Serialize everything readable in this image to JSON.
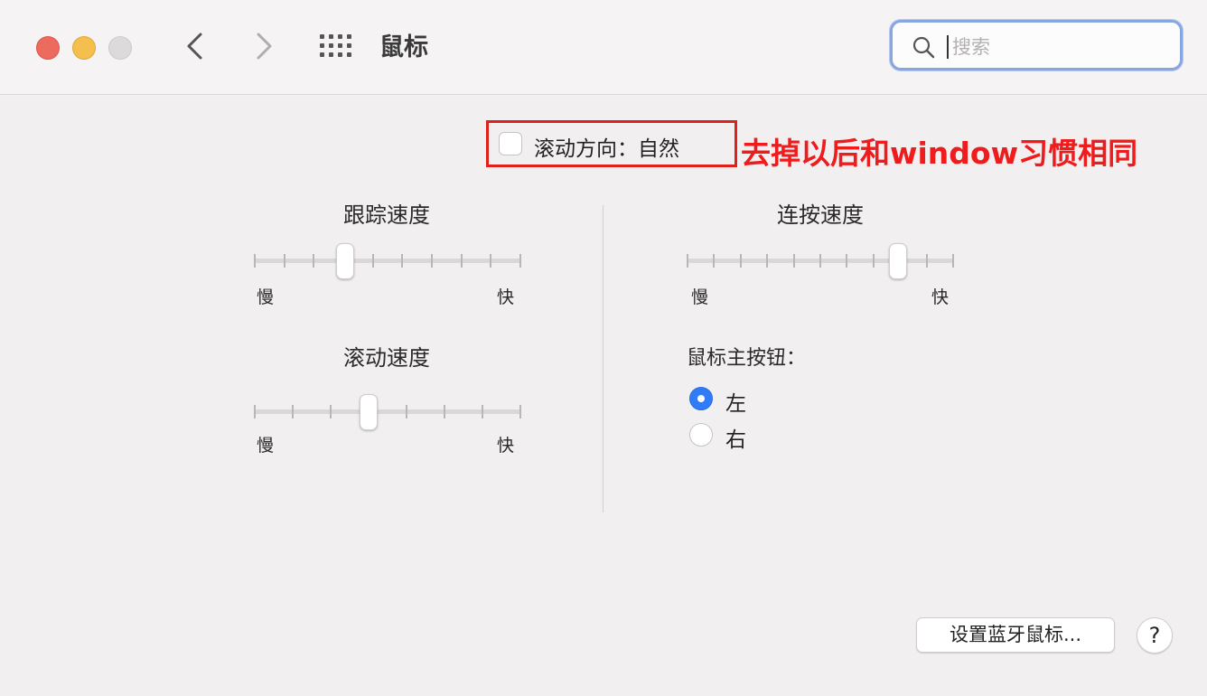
{
  "window": {
    "title": "鼠标",
    "search_placeholder": "搜索"
  },
  "icons": {
    "back": "chevron-left-icon",
    "forward": "chevron-right-icon",
    "show_all": "grid-icon",
    "search": "magnifier-icon"
  },
  "scroll_direction": {
    "label": "滚动方向：自然",
    "checked": false
  },
  "annotation": {
    "text": "去掉以后和window习惯相同",
    "color": "#ee1c1c"
  },
  "tracking_speed": {
    "title": "跟踪速度",
    "slow_label": "慢",
    "fast_label": "快",
    "value_fraction": 0.34
  },
  "scroll_speed": {
    "title": "滚动速度",
    "slow_label": "慢",
    "fast_label": "快",
    "value_fraction": 0.43
  },
  "double_click_speed": {
    "title": "连按速度",
    "slow_label": "慢",
    "fast_label": "快",
    "value_fraction": 0.79
  },
  "primary_button": {
    "label": "鼠标主按钮：",
    "options": [
      {
        "label": "左",
        "selected": true
      },
      {
        "label": "右",
        "selected": false
      }
    ]
  },
  "footer": {
    "setup_bluetooth_button": "设置蓝牙鼠标...",
    "help_button": "?"
  },
  "colors": {
    "accent": "#2f7cf6",
    "close": "#ed6a5e",
    "minimize": "#f4bf4f",
    "zoom_disabled": "#dddadc"
  }
}
